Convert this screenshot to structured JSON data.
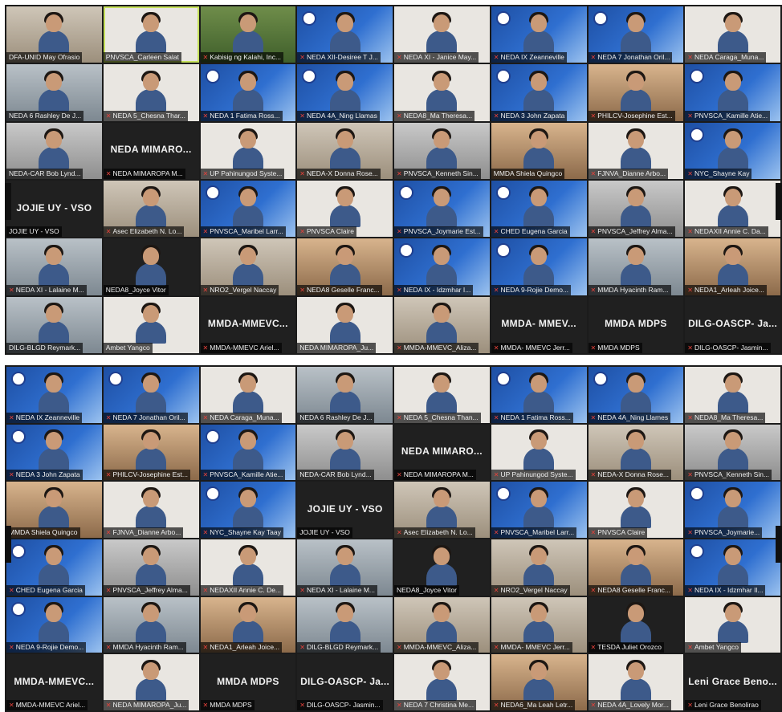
{
  "accent_color": "#c5e05a",
  "muted_icon_color": "#e5413a",
  "panel_a": {
    "tiles": [
      {
        "name": "DFA-UNID May Ofrasio",
        "muted": false,
        "display": "",
        "bg": "bg-room"
      },
      {
        "name": "PNVSCA_Carleen Salat",
        "muted": false,
        "display": "",
        "bg": "bg-white",
        "active": true
      },
      {
        "name": "Kabisig ng Kalahi, Inc...",
        "muted": true,
        "display": "",
        "bg": "bg-green"
      },
      {
        "name": "NEDA XII-Desiree T J...",
        "muted": true,
        "display": "",
        "bg": "bg-blue"
      },
      {
        "name": "NEDA XI - Janice May...",
        "muted": true,
        "display": "",
        "bg": "bg-white"
      },
      {
        "name": "NEDA IX Zeanneville",
        "muted": true,
        "display": "",
        "bg": "bg-blue"
      },
      {
        "name": "NEDA 7 Jonathan Oril...",
        "muted": true,
        "display": "",
        "bg": "bg-blue"
      },
      {
        "name": "NEDA Caraga_Muna...",
        "muted": true,
        "display": "",
        "bg": "bg-white"
      },
      {
        "name": "NEDA 6 Rashley De J...",
        "muted": false,
        "display": "",
        "bg": "bg-office"
      },
      {
        "name": "NEDA 5_Chesna Thar...",
        "muted": true,
        "display": "",
        "bg": "bg-white"
      },
      {
        "name": "NEDA 1 Fatima Ross...",
        "muted": true,
        "display": "",
        "bg": "bg-blue"
      },
      {
        "name": "NEDA 4A_Ning Llamas",
        "muted": true,
        "display": "",
        "bg": "bg-blue"
      },
      {
        "name": "NEDA8_Ma Theresa...",
        "muted": true,
        "display": "",
        "bg": "bg-white"
      },
      {
        "name": "NEDA 3 John Zapata",
        "muted": true,
        "display": "",
        "bg": "bg-blue"
      },
      {
        "name": "PHILCV-Josephine Est...",
        "muted": true,
        "display": "",
        "bg": "bg-warm"
      },
      {
        "name": "PNVSCA_Kamille Atie...",
        "muted": true,
        "display": "",
        "bg": "bg-blue"
      },
      {
        "name": "NEDA-CAR Bob Lynd...",
        "muted": false,
        "display": "",
        "bg": "bg-gray"
      },
      {
        "name": "NEDA MIMAROPA M...",
        "muted": true,
        "display": "NEDA MIMARO...",
        "bg": "dark"
      },
      {
        "name": "UP Pahinungod Syste...",
        "muted": true,
        "display": "",
        "bg": "bg-white"
      },
      {
        "name": "NEDA-X Donna Rose...",
        "muted": true,
        "display": "",
        "bg": "bg-room"
      },
      {
        "name": "PNVSCA_Kenneth Sin...",
        "muted": true,
        "display": "",
        "bg": "bg-gray"
      },
      {
        "name": "MMDA Shiela Quingco",
        "muted": false,
        "display": "",
        "bg": "bg-warm"
      },
      {
        "name": "FJNVA_Dianne Arbo...",
        "muted": true,
        "display": "",
        "bg": "bg-white"
      },
      {
        "name": "NYC_Shayne Kay",
        "muted": true,
        "display": "",
        "bg": "bg-blue"
      },
      {
        "name": "JOJIE UY - VSO",
        "muted": false,
        "display": "JOJIE UY - VSO",
        "bg": "dark"
      },
      {
        "name": "Asec Elizabeth N. Lo...",
        "muted": true,
        "display": "",
        "bg": "bg-room"
      },
      {
        "name": "PNVSCA_Maribel Larr...",
        "muted": true,
        "display": "",
        "bg": "bg-blue"
      },
      {
        "name": "PNVSCA Claire",
        "muted": true,
        "display": "",
        "bg": "bg-white"
      },
      {
        "name": "PNVSCA_Joymarie Est...",
        "muted": true,
        "display": "",
        "bg": "bg-blue"
      },
      {
        "name": "CHED Eugena Garcia",
        "muted": true,
        "display": "",
        "bg": "bg-blue"
      },
      {
        "name": "PNVSCA_Jeffrey Alma...",
        "muted": true,
        "display": "",
        "bg": "bg-gray"
      },
      {
        "name": "NEDAXII Annie C. Da...",
        "muted": true,
        "display": "",
        "bg": "bg-white"
      },
      {
        "name": "NEDA XI - Lalaine M...",
        "muted": true,
        "display": "",
        "bg": "bg-office"
      },
      {
        "name": "NEDA8_Joyce Vitor",
        "muted": false,
        "display": "",
        "bg": "dark"
      },
      {
        "name": "NRO2_Vergel Naccay",
        "muted": true,
        "display": "",
        "bg": "bg-room"
      },
      {
        "name": "NEDA8 Geselle Franc...",
        "muted": true,
        "display": "",
        "bg": "bg-warm"
      },
      {
        "name": "NEDA IX - Idzmhar I...",
        "muted": true,
        "display": "",
        "bg": "bg-blue"
      },
      {
        "name": "NEDA 9-Rojie Demo...",
        "muted": true,
        "display": "",
        "bg": "bg-blue"
      },
      {
        "name": "MMDA Hyacinth Ram...",
        "muted": true,
        "display": "",
        "bg": "bg-office"
      },
      {
        "name": "NEDA1_Arleah Joice...",
        "muted": true,
        "display": "",
        "bg": "bg-warm"
      },
      {
        "name": "DILG-BLGD Reymark...",
        "muted": false,
        "display": "",
        "bg": "bg-office"
      },
      {
        "name": "Ambet Yangco",
        "muted": false,
        "display": "",
        "bg": "bg-white"
      },
      {
        "name": "MMDA-MMEVC Ariel...",
        "muted": true,
        "display": "MMDA-MMEVC...",
        "bg": "dark"
      },
      {
        "name": "NEDA MIMAROPA_Ju...",
        "muted": false,
        "display": "",
        "bg": "bg-white"
      },
      {
        "name": "MMDA-MMEVC_Aliza...",
        "muted": true,
        "display": "",
        "bg": "bg-room"
      },
      {
        "name": "MMDA- MMEVC Jerr...",
        "muted": true,
        "display": "MMDA- MMEV...",
        "bg": "dark"
      },
      {
        "name": "MMDA MDPS",
        "muted": true,
        "display": "MMDA MDPS",
        "bg": "dark"
      },
      {
        "name": "DILG-OASCP- Jasmin...",
        "muted": true,
        "display": "DILG-OASCP- Ja...",
        "bg": "dark"
      }
    ]
  },
  "panel_b": {
    "tiles": [
      {
        "name": "NEDA IX Zeanneville",
        "muted": true,
        "display": "",
        "bg": "bg-blue"
      },
      {
        "name": "NEDA 7 Jonathan Oril...",
        "muted": true,
        "display": "",
        "bg": "bg-blue"
      },
      {
        "name": "NEDA Caraga_Muna...",
        "muted": true,
        "display": "",
        "bg": "bg-white"
      },
      {
        "name": "NEDA 6 Rashley De J...",
        "muted": false,
        "display": "",
        "bg": "bg-office"
      },
      {
        "name": "NEDA 5_Chesna Than...",
        "muted": true,
        "display": "",
        "bg": "bg-white"
      },
      {
        "name": "NEDA 1 Fatima Ross...",
        "muted": true,
        "display": "",
        "bg": "bg-blue"
      },
      {
        "name": "NEDA 4A_Ning Llames",
        "muted": true,
        "display": "",
        "bg": "bg-blue"
      },
      {
        "name": "NEDA8_Ma Theresa...",
        "muted": true,
        "display": "",
        "bg": "bg-white"
      },
      {
        "name": "NEDA 3 John Zapata",
        "muted": true,
        "display": "",
        "bg": "bg-blue"
      },
      {
        "name": "PHILCV-Josephine Est...",
        "muted": true,
        "display": "",
        "bg": "bg-warm"
      },
      {
        "name": "PNVSCA_Kamille Atie...",
        "muted": true,
        "display": "",
        "bg": "bg-blue"
      },
      {
        "name": "NEDA-CAR Bob Lynd...",
        "muted": false,
        "display": "",
        "bg": "bg-gray"
      },
      {
        "name": "NEDA MIMAROPA M...",
        "muted": true,
        "display": "NEDA MIMARO...",
        "bg": "dark"
      },
      {
        "name": "UP Pahinungod Syste...",
        "muted": true,
        "display": "",
        "bg": "bg-white"
      },
      {
        "name": "NEDA-X Donna Rose...",
        "muted": true,
        "display": "",
        "bg": "bg-room"
      },
      {
        "name": "PNVSCA_Kenneth Sin...",
        "muted": true,
        "display": "",
        "bg": "bg-gray"
      },
      {
        "name": "MMDA Shiela Quingco",
        "muted": false,
        "display": "",
        "bg": "bg-warm"
      },
      {
        "name": "FJNVA_Dianne Arbo...",
        "muted": true,
        "display": "",
        "bg": "bg-white"
      },
      {
        "name": "NYC_Shayne Kay Taay",
        "muted": true,
        "display": "",
        "bg": "bg-blue"
      },
      {
        "name": "JOJIE UY - VSO",
        "muted": false,
        "display": "JOJIE UY - VSO",
        "bg": "dark"
      },
      {
        "name": "Asec Elizabeth N. Lo...",
        "muted": true,
        "display": "",
        "bg": "bg-room"
      },
      {
        "name": "PNVSCA_Maribel Larr...",
        "muted": true,
        "display": "",
        "bg": "bg-blue"
      },
      {
        "name": "PNVSCA Claire",
        "muted": true,
        "display": "",
        "bg": "bg-white"
      },
      {
        "name": "PNVSCA_Joymarie...",
        "muted": true,
        "display": "",
        "bg": "bg-blue"
      },
      {
        "name": "CHED Eugena Garcia",
        "muted": true,
        "display": "",
        "bg": "bg-blue"
      },
      {
        "name": "PNVSCA_Jeffrey Alma...",
        "muted": true,
        "display": "",
        "bg": "bg-gray"
      },
      {
        "name": "NEDAXII Annie C. De...",
        "muted": true,
        "display": "",
        "bg": "bg-white"
      },
      {
        "name": "NEDA XI - Lalaine M...",
        "muted": true,
        "display": "",
        "bg": "bg-office"
      },
      {
        "name": "NEDA8_Joyce Vitor",
        "muted": false,
        "display": "",
        "bg": "dark"
      },
      {
        "name": "NRO2_Vergel Naccay",
        "muted": true,
        "display": "",
        "bg": "bg-room"
      },
      {
        "name": "NEDA8 Geselle Franc...",
        "muted": true,
        "display": "",
        "bg": "bg-warm"
      },
      {
        "name": "NEDA IX - Idzmhar Il...",
        "muted": true,
        "display": "",
        "bg": "bg-blue"
      },
      {
        "name": "NEDA 9-Rojie Demo...",
        "muted": true,
        "display": "",
        "bg": "bg-blue"
      },
      {
        "name": "MMDA Hyacinth Ram...",
        "muted": true,
        "display": "",
        "bg": "bg-office"
      },
      {
        "name": "NEDA1_Arleah Joice...",
        "muted": true,
        "display": "",
        "bg": "bg-warm"
      },
      {
        "name": "DILG-BLGD Reymark...",
        "muted": true,
        "display": "",
        "bg": "bg-office"
      },
      {
        "name": "MMDA-MMEVC_Aliza...",
        "muted": true,
        "display": "",
        "bg": "bg-room"
      },
      {
        "name": "MMDA- MMEVC Jerr...",
        "muted": true,
        "display": "",
        "bg": "bg-room"
      },
      {
        "name": "TESDA Juliet Orozco",
        "muted": true,
        "display": "",
        "bg": "dark"
      },
      {
        "name": "Ambet Yangco",
        "muted": true,
        "display": "",
        "bg": "bg-white"
      },
      {
        "name": "MMDA-MMEVC Ariel...",
        "muted": true,
        "display": "MMDA-MMEVC...",
        "bg": "dark"
      },
      {
        "name": "NEDA MIMAROPA_Ju...",
        "muted": true,
        "display": "",
        "bg": "bg-white"
      },
      {
        "name": "MMDA MDPS",
        "muted": true,
        "display": "MMDA MDPS",
        "bg": "dark"
      },
      {
        "name": "DILG-OASCP- Jasmin...",
        "muted": true,
        "display": "DILG-OASCP- Ja...",
        "bg": "dark"
      },
      {
        "name": "NEDA 7 Christina Me...",
        "muted": true,
        "display": "",
        "bg": "bg-white"
      },
      {
        "name": "NEDA6_Ma Leah Letr...",
        "muted": true,
        "display": "",
        "bg": "bg-warm"
      },
      {
        "name": "NEDA 4A_Lovely Mor...",
        "muted": true,
        "display": "",
        "bg": "bg-white"
      },
      {
        "name": "Leni Grace Benolirao",
        "muted": true,
        "display": "Leni Grace Beno...",
        "bg": "dark"
      }
    ]
  }
}
